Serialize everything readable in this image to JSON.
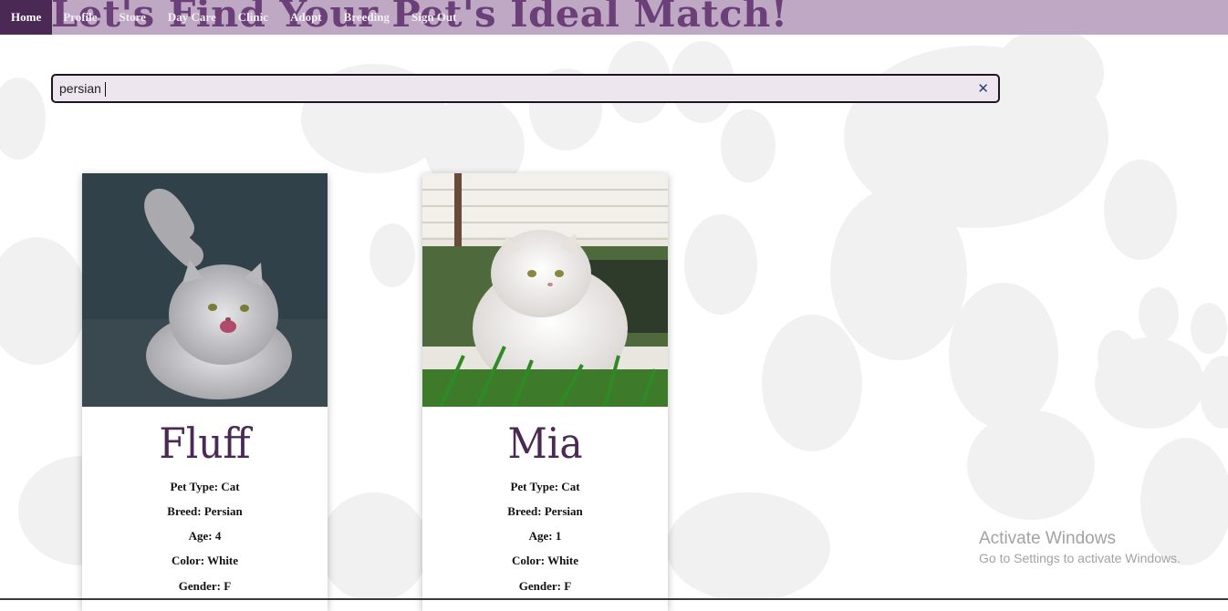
{
  "nav": {
    "items": [
      {
        "label": "Home",
        "active": true
      },
      {
        "label": "Profile"
      },
      {
        "label": "Store"
      },
      {
        "label": "Day Care"
      },
      {
        "label": "Clinic"
      },
      {
        "label": "Adopt"
      },
      {
        "label": "Breeding"
      },
      {
        "label": "Sign Out"
      }
    ]
  },
  "header": {
    "title": "Let's Find Your Pet's Ideal Match!"
  },
  "search": {
    "value": "persian",
    "clear_icon": "close-icon"
  },
  "pets": [
    {
      "name": "Fluff",
      "type_label": "Pet Type: Cat",
      "breed_label": "Breed: Persian",
      "age_label": "Age: 4",
      "color_label": "Color: White",
      "gender_label": "Gender: F"
    },
    {
      "name": "Mia",
      "type_label": "Pet Type: Cat",
      "breed_label": "Breed: Persian",
      "age_label": "Age: 1",
      "color_label": "Color: White",
      "gender_label": "Gender: F"
    }
  ],
  "watermark": {
    "title": "Activate Windows",
    "subtitle": "Go to Settings to activate Windows."
  },
  "colors": {
    "navbar": "#bfa8c4",
    "nav_active": "#4a2a55",
    "title": "#6b3f78",
    "pet_name": "#4a2a55"
  }
}
